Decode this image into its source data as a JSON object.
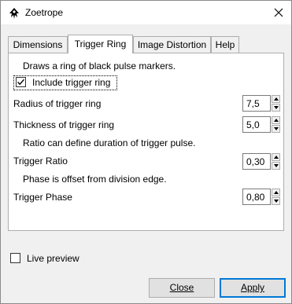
{
  "window": {
    "title": "Zoetrope"
  },
  "tabs": [
    {
      "label": "Dimensions",
      "active": false
    },
    {
      "label": "Trigger Ring",
      "active": true
    },
    {
      "label": "Image Distortion",
      "active": false
    },
    {
      "label": "Help",
      "active": false
    }
  ],
  "panel": {
    "description": "Draws a ring of black pulse markers.",
    "include_trigger_ring": {
      "label": "Include trigger ring",
      "checked": true
    },
    "radius": {
      "label": "Radius of trigger ring",
      "value": "7,5"
    },
    "thickness": {
      "label": "Thickness of trigger ring",
      "value": "5,0"
    },
    "ratio_note": "Ratio can define duration of trigger pulse.",
    "ratio": {
      "label": "Trigger Ratio",
      "value": "0,30"
    },
    "phase_note": "Phase is offset from division edge.",
    "phase": {
      "label": "Trigger Phase",
      "value": "0,80"
    }
  },
  "live_preview": {
    "label": "Live preview",
    "checked": false
  },
  "buttons": {
    "close": "Close",
    "apply": "Apply"
  },
  "colors": {
    "accent": "#0078d7",
    "window_bg": "#f0f0f0",
    "panel_bg": "#ffffff"
  },
  "icons": {
    "app": "inkscape-icon",
    "close": "close-icon",
    "check": "checkmark-icon",
    "spin_up": "chevron-up-icon",
    "spin_down": "chevron-down-icon"
  }
}
